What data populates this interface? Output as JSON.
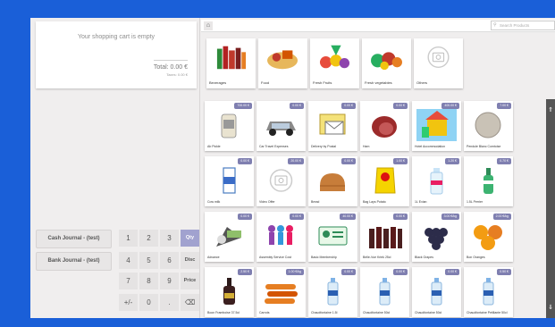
{
  "cart": {
    "empty_text": "Your shopping cart is empty",
    "total": "Total: 0.00 €",
    "taxes": "Taxes: 0.00 €"
  },
  "journals": [
    "Cash Journal - (test)",
    "Bank Journal - (test)"
  ],
  "numpad": [
    "1",
    "2",
    "3",
    "Qty",
    "4",
    "5",
    "6",
    "Disc",
    "7",
    "8",
    "9",
    "Price",
    "+/-",
    "0",
    ".",
    "⌫"
  ],
  "numpad_selected": "Qty",
  "topbar": {
    "home_icon": "home-icon",
    "search_placeholder": "Search Products"
  },
  "categories": [
    {
      "name": "Beverages",
      "icon": "bottles-image"
    },
    {
      "name": "Food",
      "icon": "food-image"
    },
    {
      "name": "Fresh Fruits",
      "icon": "fruits-image"
    },
    {
      "name": "Fresh vegetables",
      "icon": "vegetables-image"
    },
    {
      "name": "Others",
      "icon": "camera-placeholder-icon"
    }
  ],
  "products": [
    {
      "name": "Ab Pickle",
      "price": "700.00 €",
      "img": "ab-pickle"
    },
    {
      "name": "Car Travel Expenses",
      "price": "0.00 €",
      "img": "car"
    },
    {
      "name": "Delivery by Postal",
      "price": "0.00 €",
      "img": "envelope"
    },
    {
      "name": "Ham",
      "price": "0.00 €",
      "img": "ham"
    },
    {
      "name": "Hotel Accommodation",
      "price": "400.00 €",
      "img": "hotel"
    },
    {
      "name": "Pendule Blanc Comtoise",
      "price": "7.00 €",
      "img": "coin"
    },
    {
      "name": "Cow milk",
      "price": "0.00 €",
      "img": "milk"
    },
    {
      "name": "Video Offer",
      "price": "20.00 €",
      "img": "placeholder"
    },
    {
      "name": "Bread",
      "price": "0.00 €",
      "img": "bread"
    },
    {
      "name": "Bag Lays Potato",
      "price": "1.00 €",
      "img": "chips"
    },
    {
      "name": "1L Evian",
      "price": "1.20 €",
      "img": "evian"
    },
    {
      "name": "1.5L Perrier",
      "price": "0.70 €",
      "img": "perrier"
    },
    {
      "name": "Advance",
      "price": "0.00 €",
      "img": "advance"
    },
    {
      "name": "Assembly Service Cost",
      "price": "0.00 €",
      "img": "people"
    },
    {
      "name": "Basic Membership",
      "price": "40.00 €",
      "img": "card"
    },
    {
      "name": "Belle-Vue Kriek 25cl",
      "price": "0.00 €",
      "img": "beer"
    },
    {
      "name": "Black Grapes",
      "price": "3.00 €/kg",
      "img": "grapes"
    },
    {
      "name": "Bon Oranges",
      "price": "2.00 €/kg",
      "img": "oranges"
    },
    {
      "name": "Boon Framboise 37.5cl",
      "price": "2.50 €",
      "img": "wine"
    },
    {
      "name": "Carrots",
      "price": "1.00 €/kg",
      "img": "carrots"
    },
    {
      "name": "Chaudfontaine 1.5l",
      "price": "0.00 €",
      "img": "water1"
    },
    {
      "name": "Chaudfontaine 50cl",
      "price": "0.00 €",
      "img": "water2"
    },
    {
      "name": "Chaudfontaine 50cl",
      "price": "0.00 €",
      "img": "water3"
    },
    {
      "name": "Chaudfontaine Petillante 50cl",
      "price": "0.50 €",
      "img": "water4"
    }
  ]
}
